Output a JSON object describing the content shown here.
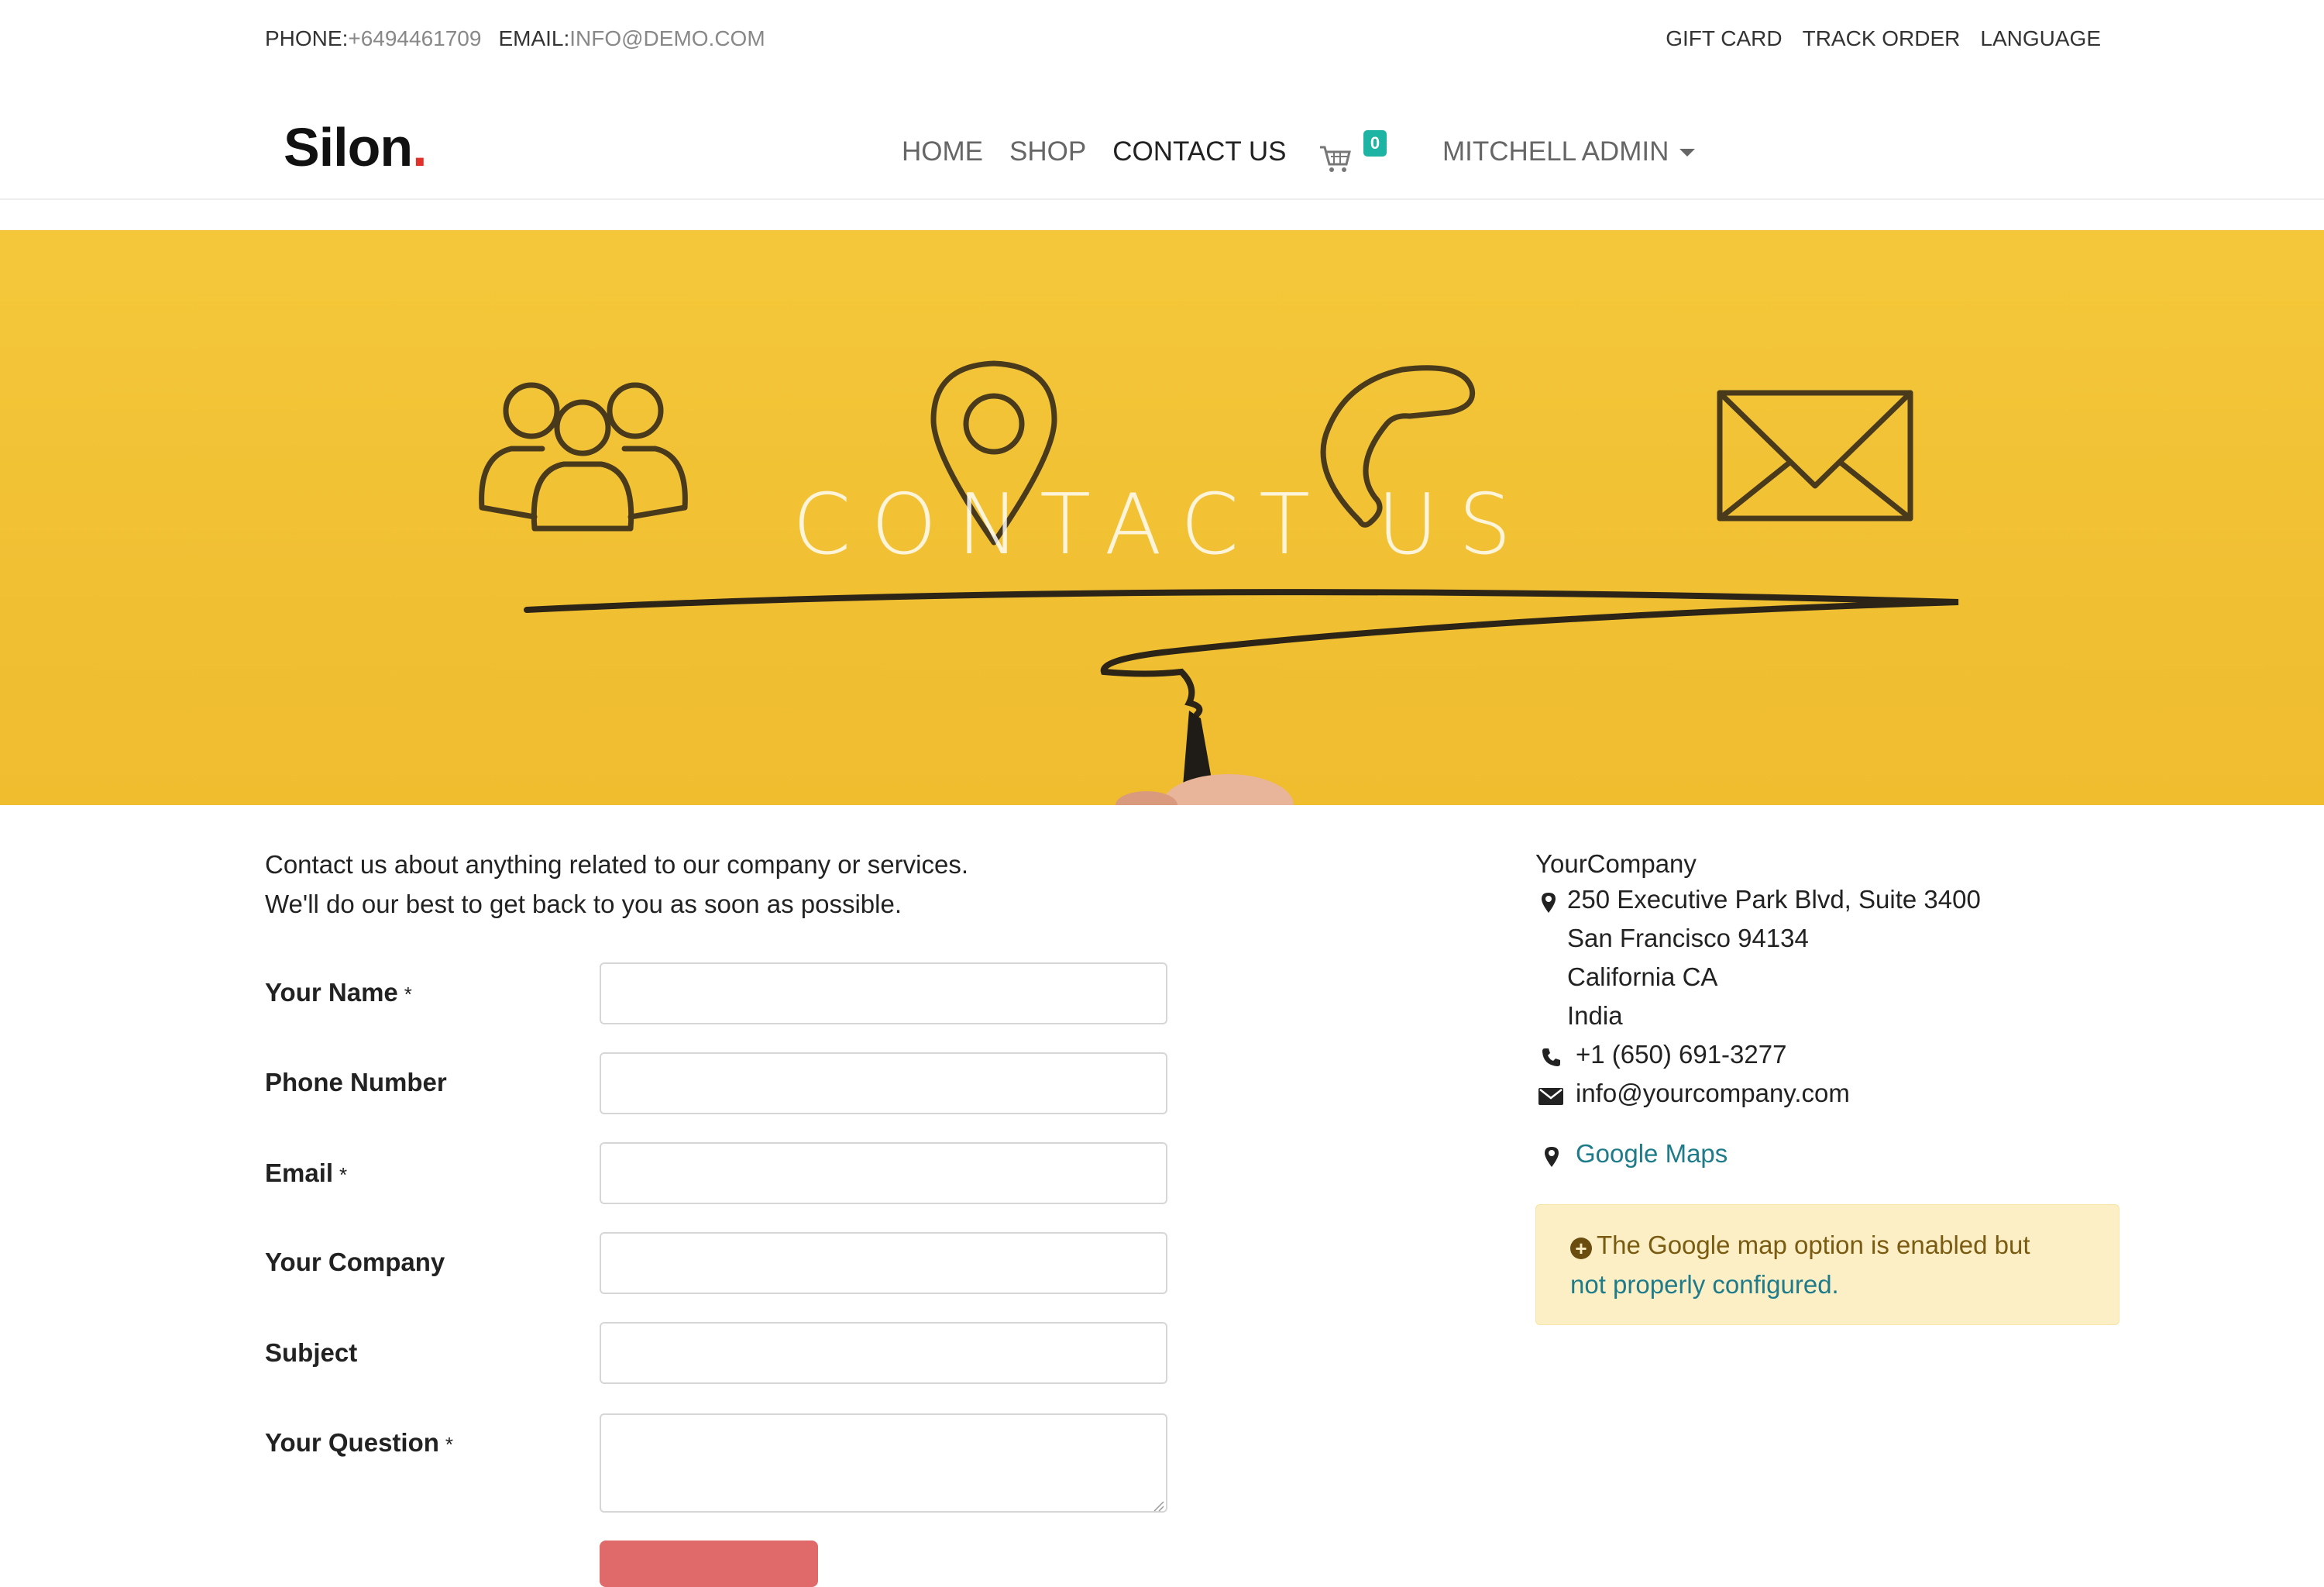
{
  "topbar": {
    "phone_label": "PHONE:",
    "phone_value": "+6494461709",
    "email_label": "EMAIL:",
    "email_value": "INFO@DEMO.COM",
    "links": [
      "GIFT CARD",
      "TRACK ORDER",
      "LANGUAGE"
    ]
  },
  "header": {
    "logo_text": "Silon",
    "logo_dot": ".",
    "nav": [
      "HOME",
      "SHOP",
      "CONTACT US"
    ],
    "active_nav": "CONTACT US",
    "cart_count": "0",
    "user_name": "MITCHELL ADMIN"
  },
  "hero": {
    "title": "CONTACT US",
    "background_color": "#f2c232",
    "icons": [
      "group-icon",
      "map-pin-icon",
      "phone-icon",
      "envelope-icon"
    ]
  },
  "intro": {
    "line1": "Contact us about anything related to our company or services.",
    "line2": "We'll do our best to get back to you as soon as possible."
  },
  "form": {
    "fields": [
      {
        "label": "Your Name",
        "required": true,
        "value": ""
      },
      {
        "label": "Phone Number",
        "required": false,
        "value": ""
      },
      {
        "label": "Email",
        "required": true,
        "value": ""
      },
      {
        "label": "Your Company",
        "required": false,
        "value": ""
      },
      {
        "label": "Subject",
        "required": false,
        "value": ""
      },
      {
        "label": "Your Question",
        "required": true,
        "value": ""
      }
    ],
    "required_mark": "*",
    "submit_color": "#e06a6a"
  },
  "contact_info": {
    "company": "YourCompany",
    "address_line1": "250 Executive Park Blvd, Suite 3400",
    "address_line2": "San Francisco 94134",
    "address_line3": "California CA",
    "address_line4": "India",
    "phone": "+1 (650) 691-3277",
    "email": "info@yourcompany.com",
    "maps_link": "Google Maps"
  },
  "alert": {
    "text_part1": "The Google map option is enabled but",
    "text_part2": "not properly configured."
  },
  "colors": {
    "accent_teal": "#1eb4a4",
    "link": "#1e7b8a",
    "alert_bg": "#fcefc6"
  }
}
